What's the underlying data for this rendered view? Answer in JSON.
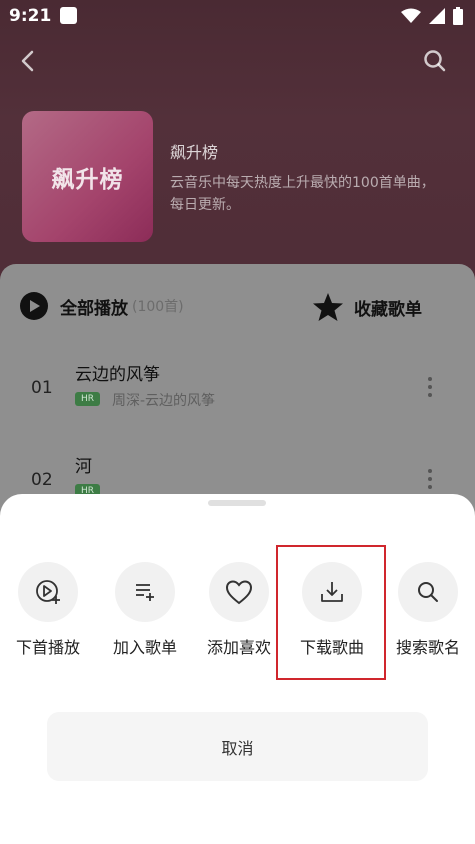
{
  "status_bar": {
    "time": "9:21"
  },
  "header": {
    "cover_text": "飙升榜",
    "title": "飙升榜",
    "description": "云音乐中每天热度上升最快的100首单曲，每日更新。"
  },
  "list_header": {
    "play_all_label": "全部播放",
    "play_all_count": "(100首)",
    "collect_label": "收藏歌单"
  },
  "songs": [
    {
      "index": "01",
      "name": "云边的风筝",
      "badge": "HR",
      "subtitle": "周深-云边的风筝"
    },
    {
      "index": "02",
      "name": "河",
      "badge": "HR",
      "subtitle": ""
    }
  ],
  "sheet": {
    "actions": [
      {
        "label": "下首播放",
        "icon": "play-next-icon"
      },
      {
        "label": "加入歌单",
        "icon": "add-to-playlist-icon"
      },
      {
        "label": "添加喜欢",
        "icon": "heart-icon"
      },
      {
        "label": "下载歌曲",
        "icon": "download-icon"
      },
      {
        "label": "搜索歌名",
        "icon": "search-icon"
      }
    ],
    "cancel_label": "取消"
  },
  "colors": {
    "highlight": "#d0262d",
    "hr_badge": "#3d7c45"
  }
}
